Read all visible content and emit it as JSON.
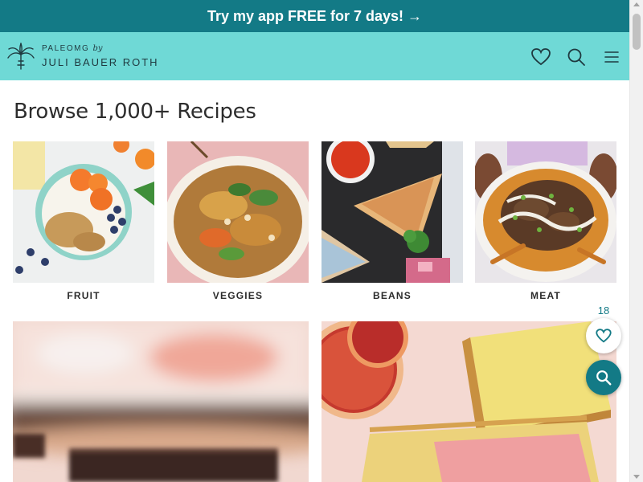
{
  "promo": {
    "text": "Try my app FREE for 7 days! →"
  },
  "header": {
    "logo_line1": "PALEOMG",
    "logo_by": "by",
    "logo_line2": "JULI BAUER ROTH",
    "icons": [
      "heart-icon",
      "search-icon",
      "menu-icon"
    ]
  },
  "main": {
    "title": "Browse 1,000+ Recipes",
    "categories": [
      {
        "label": "FRUIT"
      },
      {
        "label": "VEGGIES"
      },
      {
        "label": "BEANS"
      },
      {
        "label": "MEAT"
      }
    ]
  },
  "floating": {
    "favorite_count": "18"
  },
  "colors": {
    "promo_bg": "#137a86",
    "header_bg": "#6fd9d6",
    "accent": "#137a86"
  }
}
